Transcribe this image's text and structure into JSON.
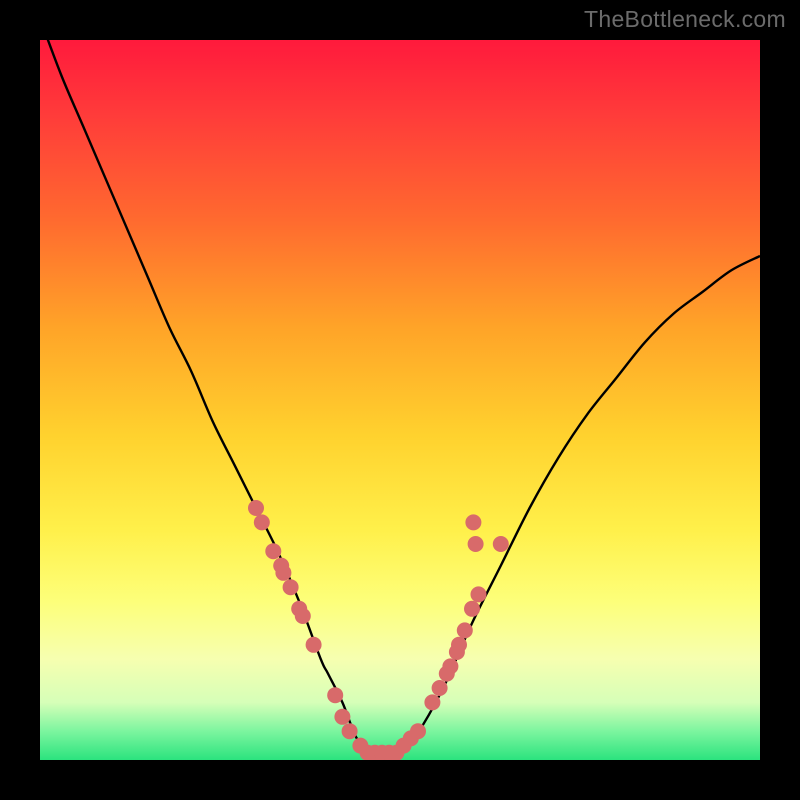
{
  "watermark": "TheBottleneck.com",
  "colors": {
    "frame": "#000000",
    "curve": "#000000",
    "dot": "#d86a6a",
    "gradient_top": "#ff1a3c",
    "gradient_bottom": "#2be37e"
  },
  "chart_data": {
    "type": "line",
    "title": "",
    "xlabel": "",
    "ylabel": "",
    "xlim": [
      0,
      100
    ],
    "ylim": [
      0,
      100
    ],
    "series": [
      {
        "name": "bottleneck-curve",
        "x": [
          0,
          3,
          6,
          9,
          12,
          15,
          18,
          21,
          24,
          27,
          30,
          33,
          36,
          39,
          40,
          42,
          44,
          46,
          48,
          50,
          52,
          56,
          60,
          64,
          68,
          72,
          76,
          80,
          84,
          88,
          92,
          96,
          100
        ],
        "y": [
          103,
          95,
          88,
          81,
          74,
          67,
          60,
          54,
          47,
          41,
          35,
          29,
          22,
          14,
          12,
          8,
          3,
          1,
          1,
          1,
          3,
          10,
          19,
          27,
          35,
          42,
          48,
          53,
          58,
          62,
          65,
          68,
          70
        ]
      }
    ],
    "points": [
      {
        "x": 30.0,
        "y": 35
      },
      {
        "x": 30.8,
        "y": 33
      },
      {
        "x": 32.4,
        "y": 29
      },
      {
        "x": 33.5,
        "y": 27
      },
      {
        "x": 33.8,
        "y": 26
      },
      {
        "x": 34.8,
        "y": 24
      },
      {
        "x": 36.0,
        "y": 21
      },
      {
        "x": 36.5,
        "y": 20
      },
      {
        "x": 38.0,
        "y": 16
      },
      {
        "x": 41.0,
        "y": 9
      },
      {
        "x": 42.0,
        "y": 6
      },
      {
        "x": 43.0,
        "y": 4
      },
      {
        "x": 44.5,
        "y": 2
      },
      {
        "x": 45.5,
        "y": 1
      },
      {
        "x": 46.5,
        "y": 1
      },
      {
        "x": 47.5,
        "y": 1
      },
      {
        "x": 48.5,
        "y": 1
      },
      {
        "x": 49.5,
        "y": 1
      },
      {
        "x": 50.5,
        "y": 2
      },
      {
        "x": 51.5,
        "y": 3
      },
      {
        "x": 52.5,
        "y": 4
      },
      {
        "x": 54.5,
        "y": 8
      },
      {
        "x": 55.5,
        "y": 10
      },
      {
        "x": 56.5,
        "y": 12
      },
      {
        "x": 57.0,
        "y": 13
      },
      {
        "x": 57.9,
        "y": 15
      },
      {
        "x": 58.2,
        "y": 16
      },
      {
        "x": 59.0,
        "y": 18
      },
      {
        "x": 60.0,
        "y": 21
      },
      {
        "x": 60.9,
        "y": 23
      },
      {
        "x": 60.5,
        "y": 30
      },
      {
        "x": 60.2,
        "y": 33
      },
      {
        "x": 64.0,
        "y": 30
      }
    ],
    "annotations": []
  }
}
